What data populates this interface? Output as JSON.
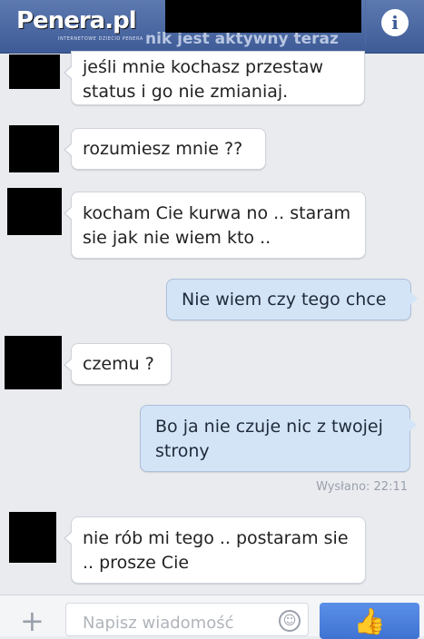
{
  "header": {
    "logo": "Penera.pl",
    "logo_subtitle": "INTERNETOWE DZIECIO PENERA",
    "status": "nik jest aktywny teraz",
    "info_icon": "info-icon"
  },
  "messages": [
    {
      "direction": "in",
      "text": "jeśli mnie kochasz przestaw status i go nie zmianiaj."
    },
    {
      "direction": "in",
      "text": "rozumiesz mnie ??"
    },
    {
      "direction": "in",
      "text": "kocham Cie kurwa no .. staram sie jak nie wiem kto .."
    },
    {
      "direction": "out",
      "text": "Nie wiem czy tego chce"
    },
    {
      "direction": "in",
      "text": "czemu ?"
    },
    {
      "direction": "out",
      "text": "Bo ja nie czuje nic z twojej strony"
    },
    {
      "direction": "in",
      "text": "nie rób mi tego .. postaram sie .. prosze Cie"
    }
  ],
  "sent_status": "Wysłano: 22:11",
  "composer": {
    "placeholder": "Napisz wiadomość",
    "plus_icon": "plus-icon",
    "emoji_icon": "smiley-icon",
    "like_icon": "thumbs-up-icon"
  }
}
